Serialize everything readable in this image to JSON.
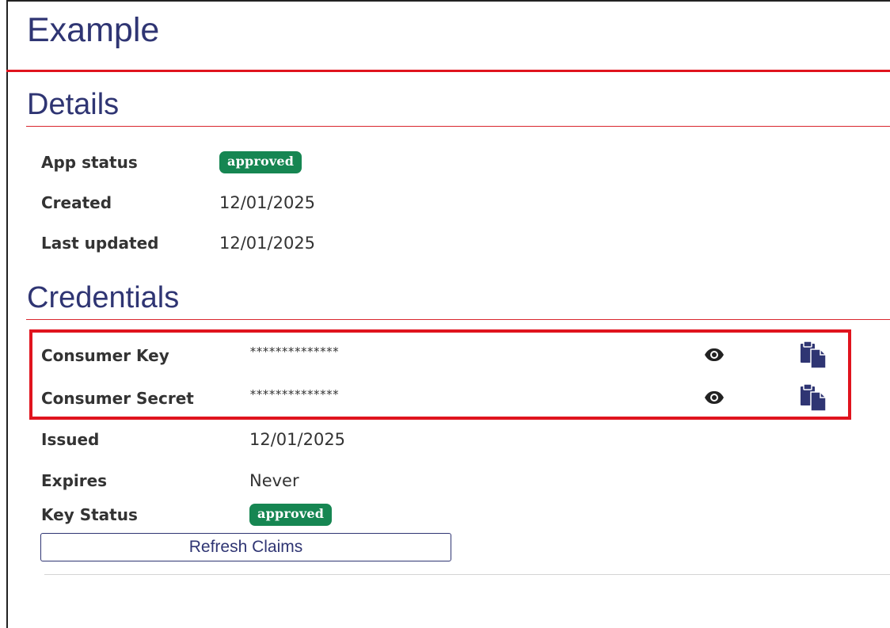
{
  "page": {
    "title": "Example"
  },
  "details": {
    "heading": "Details",
    "app_status_label": "App status",
    "app_status_value": "approved",
    "created_label": "Created",
    "created_value": "12/01/2025",
    "last_updated_label": "Last updated",
    "last_updated_value": "12/01/2025"
  },
  "credentials": {
    "heading": "Credentials",
    "consumer_key_label": "Consumer Key",
    "consumer_key_value": "**************",
    "consumer_secret_label": "Consumer Secret",
    "consumer_secret_value": "**************",
    "issued_label": "Issued",
    "issued_value": "12/01/2025",
    "expires_label": "Expires",
    "expires_value": "Never",
    "key_status_label": "Key Status",
    "key_status_value": "approved",
    "refresh_button": "Refresh Claims"
  },
  "icons": {
    "reveal": "eye-icon",
    "copy": "clipboard-copy-icon"
  },
  "colors": {
    "heading": "#2f3573",
    "accent_red": "#e0141e",
    "badge_green": "#168652",
    "text": "#333333"
  }
}
